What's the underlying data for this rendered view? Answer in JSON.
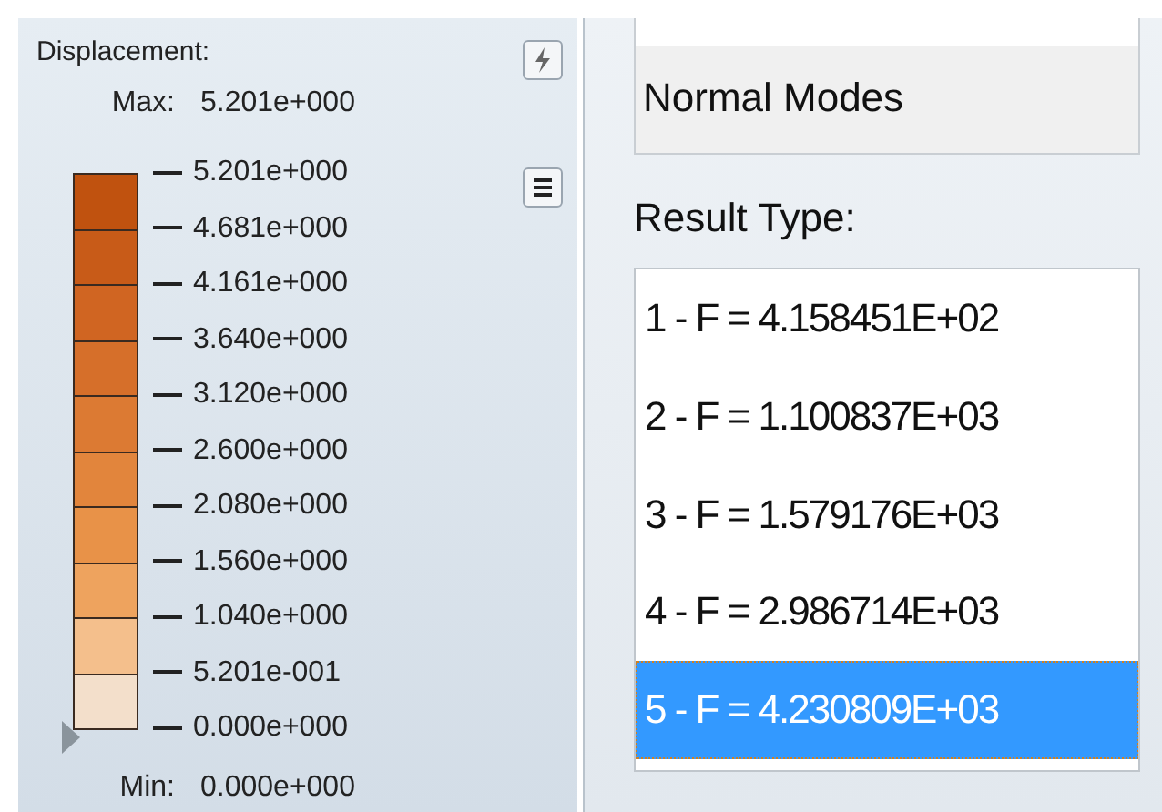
{
  "legend": {
    "title": "Displacement:",
    "max_label": "Max:",
    "max_value": "5.201e+000",
    "min_label": "Min:",
    "min_value": "0.000e+000",
    "ticks": [
      "5.201e+000",
      "4.681e+000",
      "4.161e+000",
      "3.640e+000",
      "3.120e+000",
      "2.600e+000",
      "2.080e+000",
      "1.560e+000",
      "1.040e+000",
      "5.201e-001",
      "0.000e+000"
    ],
    "bands": [
      {
        "color": "#c0520f"
      },
      {
        "color": "#c85b18"
      },
      {
        "color": "#d06522"
      },
      {
        "color": "#d66f2a"
      },
      {
        "color": "#dc7a33"
      },
      {
        "color": "#e2853c"
      },
      {
        "color": "#e89248"
      },
      {
        "color": "#eea35e"
      },
      {
        "color": "#f4bf8c"
      },
      {
        "color": "#f3dfcb"
      }
    ]
  },
  "subcase": {
    "value": "Normal Modes"
  },
  "result_type": {
    "label": "Result Type:",
    "items": [
      {
        "label": "1 - F = 4.158451E+02",
        "selected": false
      },
      {
        "label": "2 - F = 1.100837E+03",
        "selected": false
      },
      {
        "label": "3 - F = 1.579176E+03",
        "selected": false
      },
      {
        "label": "4 - F = 2.986714E+03",
        "selected": false
      },
      {
        "label": "5 - F = 4.230809E+03",
        "selected": true
      }
    ]
  }
}
